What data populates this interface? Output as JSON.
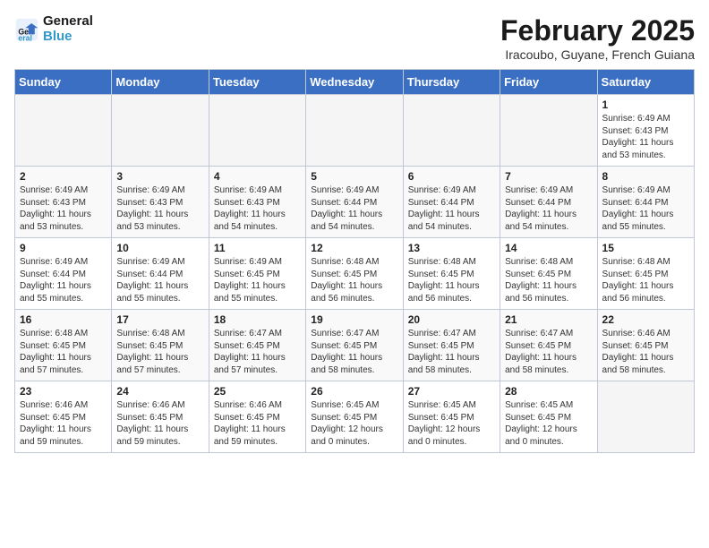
{
  "header": {
    "logo_general": "General",
    "logo_blue": "Blue",
    "month_title": "February 2025",
    "location": "Iracoubo, Guyane, French Guiana"
  },
  "days_of_week": [
    "Sunday",
    "Monday",
    "Tuesday",
    "Wednesday",
    "Thursday",
    "Friday",
    "Saturday"
  ],
  "weeks": [
    [
      {
        "day": "",
        "info": "",
        "empty": true
      },
      {
        "day": "",
        "info": "",
        "empty": true
      },
      {
        "day": "",
        "info": "",
        "empty": true
      },
      {
        "day": "",
        "info": "",
        "empty": true
      },
      {
        "day": "",
        "info": "",
        "empty": true
      },
      {
        "day": "",
        "info": "",
        "empty": true
      },
      {
        "day": "1",
        "info": "Sunrise: 6:49 AM\nSunset: 6:43 PM\nDaylight: 11 hours and 53 minutes."
      }
    ],
    [
      {
        "day": "2",
        "info": "Sunrise: 6:49 AM\nSunset: 6:43 PM\nDaylight: 11 hours and 53 minutes."
      },
      {
        "day": "3",
        "info": "Sunrise: 6:49 AM\nSunset: 6:43 PM\nDaylight: 11 hours and 53 minutes."
      },
      {
        "day": "4",
        "info": "Sunrise: 6:49 AM\nSunset: 6:43 PM\nDaylight: 11 hours and 54 minutes."
      },
      {
        "day": "5",
        "info": "Sunrise: 6:49 AM\nSunset: 6:44 PM\nDaylight: 11 hours and 54 minutes."
      },
      {
        "day": "6",
        "info": "Sunrise: 6:49 AM\nSunset: 6:44 PM\nDaylight: 11 hours and 54 minutes."
      },
      {
        "day": "7",
        "info": "Sunrise: 6:49 AM\nSunset: 6:44 PM\nDaylight: 11 hours and 54 minutes."
      },
      {
        "day": "8",
        "info": "Sunrise: 6:49 AM\nSunset: 6:44 PM\nDaylight: 11 hours and 55 minutes."
      }
    ],
    [
      {
        "day": "9",
        "info": "Sunrise: 6:49 AM\nSunset: 6:44 PM\nDaylight: 11 hours and 55 minutes."
      },
      {
        "day": "10",
        "info": "Sunrise: 6:49 AM\nSunset: 6:44 PM\nDaylight: 11 hours and 55 minutes."
      },
      {
        "day": "11",
        "info": "Sunrise: 6:49 AM\nSunset: 6:45 PM\nDaylight: 11 hours and 55 minutes."
      },
      {
        "day": "12",
        "info": "Sunrise: 6:48 AM\nSunset: 6:45 PM\nDaylight: 11 hours and 56 minutes."
      },
      {
        "day": "13",
        "info": "Sunrise: 6:48 AM\nSunset: 6:45 PM\nDaylight: 11 hours and 56 minutes."
      },
      {
        "day": "14",
        "info": "Sunrise: 6:48 AM\nSunset: 6:45 PM\nDaylight: 11 hours and 56 minutes."
      },
      {
        "day": "15",
        "info": "Sunrise: 6:48 AM\nSunset: 6:45 PM\nDaylight: 11 hours and 56 minutes."
      }
    ],
    [
      {
        "day": "16",
        "info": "Sunrise: 6:48 AM\nSunset: 6:45 PM\nDaylight: 11 hours and 57 minutes."
      },
      {
        "day": "17",
        "info": "Sunrise: 6:48 AM\nSunset: 6:45 PM\nDaylight: 11 hours and 57 minutes."
      },
      {
        "day": "18",
        "info": "Sunrise: 6:47 AM\nSunset: 6:45 PM\nDaylight: 11 hours and 57 minutes."
      },
      {
        "day": "19",
        "info": "Sunrise: 6:47 AM\nSunset: 6:45 PM\nDaylight: 11 hours and 58 minutes."
      },
      {
        "day": "20",
        "info": "Sunrise: 6:47 AM\nSunset: 6:45 PM\nDaylight: 11 hours and 58 minutes."
      },
      {
        "day": "21",
        "info": "Sunrise: 6:47 AM\nSunset: 6:45 PM\nDaylight: 11 hours and 58 minutes."
      },
      {
        "day": "22",
        "info": "Sunrise: 6:46 AM\nSunset: 6:45 PM\nDaylight: 11 hours and 58 minutes."
      }
    ],
    [
      {
        "day": "23",
        "info": "Sunrise: 6:46 AM\nSunset: 6:45 PM\nDaylight: 11 hours and 59 minutes."
      },
      {
        "day": "24",
        "info": "Sunrise: 6:46 AM\nSunset: 6:45 PM\nDaylight: 11 hours and 59 minutes."
      },
      {
        "day": "25",
        "info": "Sunrise: 6:46 AM\nSunset: 6:45 PM\nDaylight: 11 hours and 59 minutes."
      },
      {
        "day": "26",
        "info": "Sunrise: 6:45 AM\nSunset: 6:45 PM\nDaylight: 12 hours and 0 minutes."
      },
      {
        "day": "27",
        "info": "Sunrise: 6:45 AM\nSunset: 6:45 PM\nDaylight: 12 hours and 0 minutes."
      },
      {
        "day": "28",
        "info": "Sunrise: 6:45 AM\nSunset: 6:45 PM\nDaylight: 12 hours and 0 minutes."
      },
      {
        "day": "",
        "info": "",
        "empty": true
      }
    ]
  ]
}
